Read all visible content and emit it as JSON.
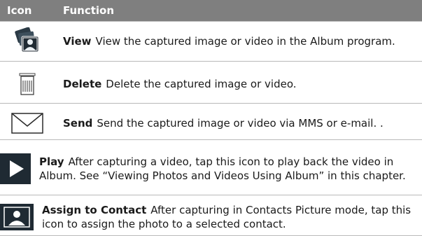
{
  "header": {
    "col_icon": "Icon",
    "col_function": "Function"
  },
  "rows": [
    {
      "icon": "album-view-icon",
      "title": "View",
      "desc": "View the captured image or video in the Album program."
    },
    {
      "icon": "trash-delete-icon",
      "title": "Delete",
      "desc": "Delete the captured image or video."
    },
    {
      "icon": "envelope-send-icon",
      "title": "Send",
      "desc": "Send the captured image or video via MMS or e-mail. ."
    },
    {
      "icon": "play-icon",
      "title": "Play",
      "desc": "After capturing a video, tap this icon to play back the video in Album. See “Viewing Photos and Videos Using Album” in this chapter."
    },
    {
      "icon": "contact-assign-icon",
      "title": "Assign to Contact",
      "desc": "After capturing in Contacts Picture mode, tap this icon to assign the photo to a selected contact."
    }
  ],
  "colors": {
    "header_bg": "#7f7f7f",
    "rule": "#b9b9b9",
    "icon_dark": "#1f2a33"
  }
}
